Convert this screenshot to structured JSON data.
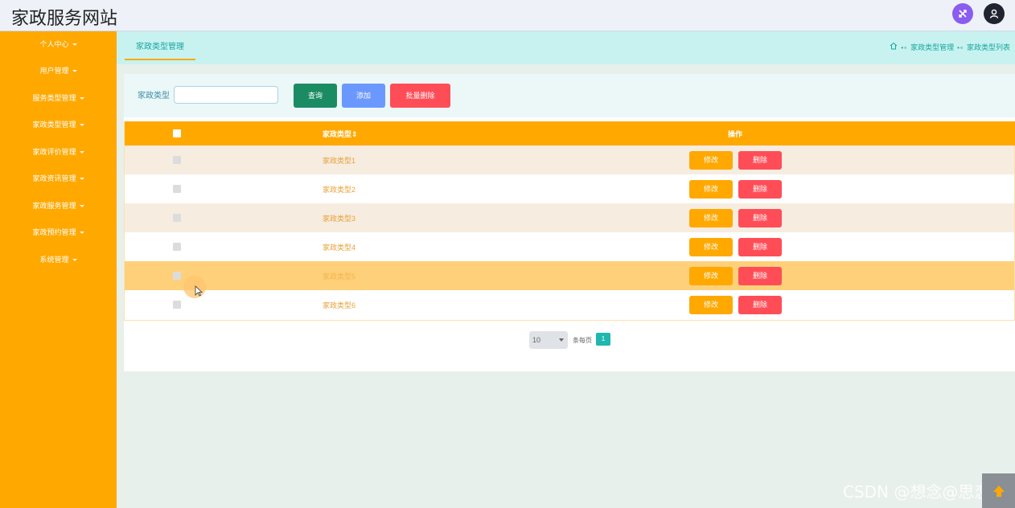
{
  "app": {
    "title": "家政服务网站"
  },
  "colors": {
    "accent": "#ffa800",
    "teal": "#1fb7b0",
    "danger": "#ff4d57",
    "primary_blue": "#6b98ff",
    "query_green": "#1b8b63"
  },
  "header_icons": {
    "swap": "shuffle-icon",
    "user": "user-icon"
  },
  "sidebar": {
    "items": [
      {
        "label": "个人中心"
      },
      {
        "label": "用户管理"
      },
      {
        "label": "服务类型管理"
      },
      {
        "label": "家政类型管理"
      },
      {
        "label": "家政评价管理"
      },
      {
        "label": "家政资讯管理"
      },
      {
        "label": "家政服务管理"
      },
      {
        "label": "家政预约管理"
      },
      {
        "label": "系统管理"
      }
    ]
  },
  "tabs": {
    "active": "家政类型管理"
  },
  "breadcrumb": {
    "home_icon": "home-icon",
    "items": [
      "家政类型管理",
      "家政类型列表"
    ]
  },
  "search": {
    "label": "家政类型",
    "value": "",
    "buttons": {
      "query": "查询",
      "add": "添加",
      "bulk_delete": "批量删除"
    }
  },
  "table": {
    "columns": {
      "type": "家政类型",
      "sort_icon": "sort-icon",
      "operation": "操作"
    },
    "edit_label": "修改",
    "delete_label": "删除",
    "rows": [
      {
        "name": "家政类型1"
      },
      {
        "name": "家政类型2"
      },
      {
        "name": "家政类型3"
      },
      {
        "name": "家政类型4"
      },
      {
        "name": "家政类型5"
      },
      {
        "name": "家政类型6"
      }
    ]
  },
  "pagination": {
    "page_size": "10",
    "total_label": "条每页",
    "current_page": "1"
  },
  "watermark": "CSDN @想念@思恋"
}
